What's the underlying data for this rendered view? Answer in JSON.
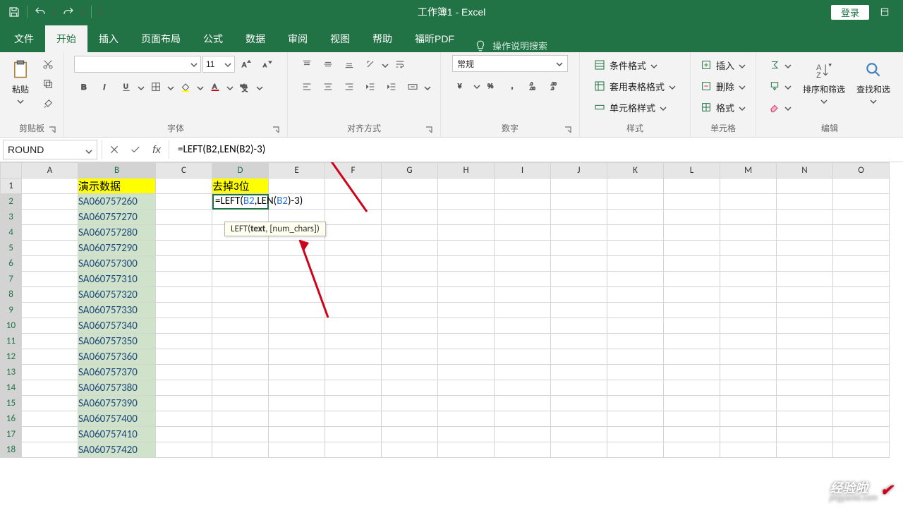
{
  "titlebar": {
    "title": "工作簿1  -  Excel",
    "login": "登录"
  },
  "tabs": {
    "file": "文件",
    "home": "开始",
    "insert": "插入",
    "layout": "页面布局",
    "formulas": "公式",
    "data": "数据",
    "review": "审阅",
    "view": "视图",
    "help": "帮助",
    "foxit": "福昕PDF",
    "tellme": "操作说明搜索"
  },
  "ribbon": {
    "clipboard": {
      "label": "剪贴板",
      "paste": "粘贴"
    },
    "font": {
      "label": "字体",
      "size": "11"
    },
    "align": {
      "label": "对齐方式"
    },
    "number": {
      "label": "数字",
      "format": "常规"
    },
    "styles": {
      "label": "样式",
      "cond": "条件格式",
      "table": "套用表格格式",
      "cell": "单元格样式"
    },
    "cells": {
      "label": "单元格",
      "insert": "插入",
      "delete": "删除",
      "format": "格式"
    },
    "editing": {
      "label": "编辑",
      "sort": "排序和筛选",
      "find": "查找和选"
    }
  },
  "formulabar": {
    "name": "ROUND",
    "fx": "fx",
    "formula": "=LEFT(B2,LEN(B2)-3)"
  },
  "headers": {
    "b1": "演示数据",
    "d1": "去掉3位"
  },
  "cell_edit": {
    "p1": "=LEFT(",
    "ref1": "B2",
    "p2": ",LEN(",
    "ref2": "B2",
    "p3": ")-3)"
  },
  "tooltip": {
    "pre": "LEFT(",
    "bold": "text",
    "post": ", [num_chars])"
  },
  "columns": [
    "A",
    "B",
    "C",
    "D",
    "E",
    "F",
    "G",
    "H",
    "I",
    "J",
    "K",
    "L",
    "M",
    "N",
    "O"
  ],
  "rows": [
    1,
    2,
    3,
    4,
    5,
    6,
    7,
    8,
    9,
    10,
    11,
    12,
    13,
    14,
    15,
    16,
    17,
    18
  ],
  "data_b": [
    "SA060757260",
    "SA060757270",
    "SA060757280",
    "SA060757290",
    "SA060757300",
    "SA060757310",
    "SA060757320",
    "SA060757330",
    "SA060757340",
    "SA060757350",
    "SA060757360",
    "SA060757370",
    "SA060757380",
    "SA060757390",
    "SA060757400",
    "SA060757410",
    "SA060757420"
  ],
  "watermark": {
    "line1": "经验啦",
    "line2": "jingyanla.com"
  }
}
